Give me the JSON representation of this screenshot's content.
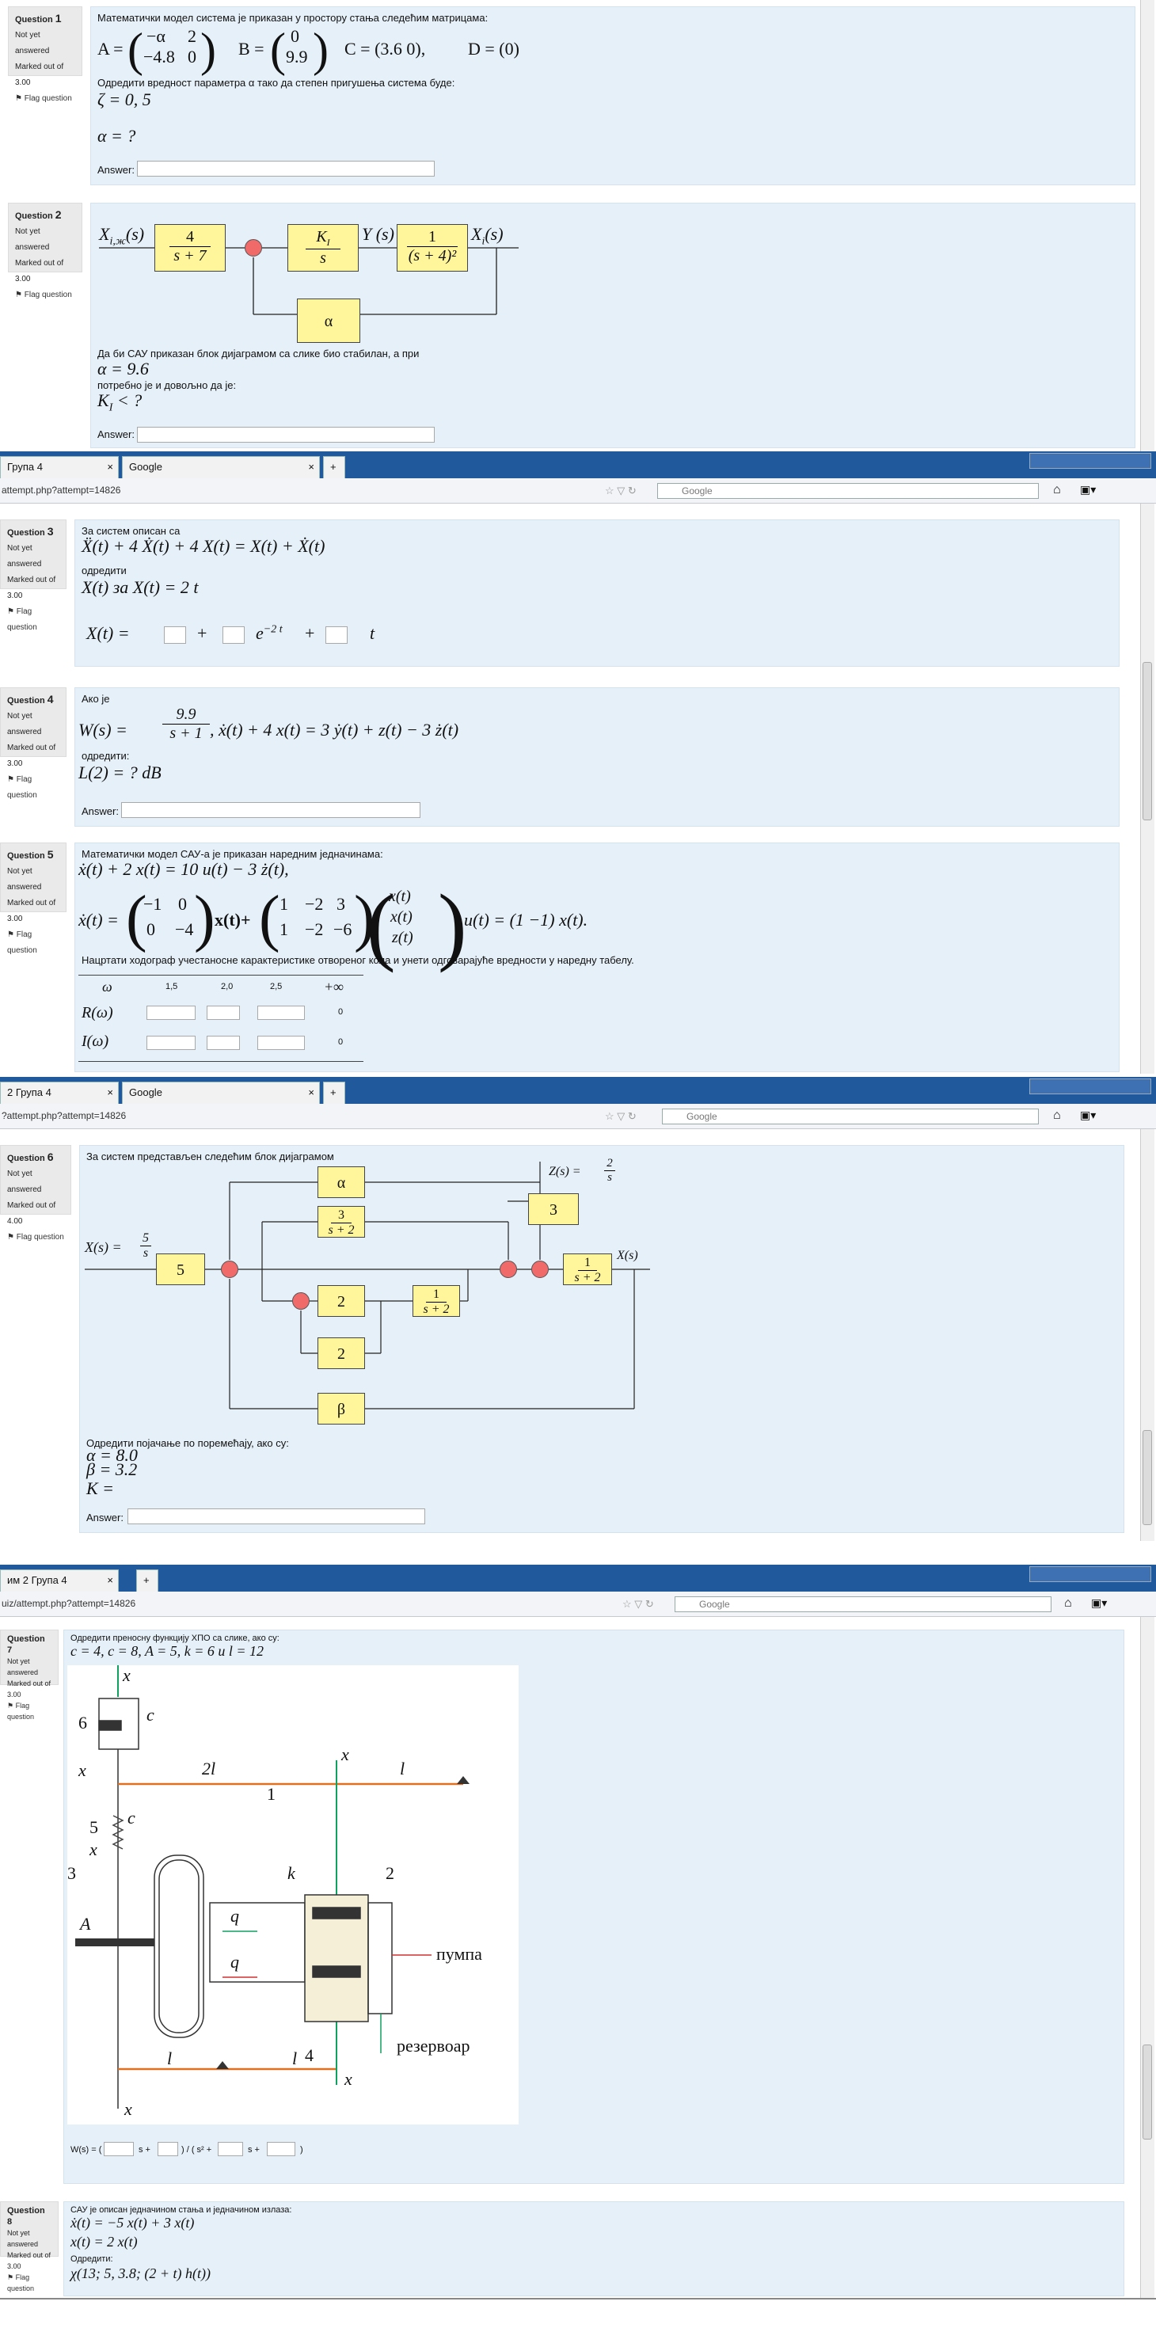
{
  "browser": {
    "tab_title_1": "Група 4",
    "tab_title_2": "Google",
    "tab_title_3": "2 Група 4",
    "tab_title_4": "им 2 Група 4",
    "url_1": "attempt.php?attempt=14826",
    "url_2": "?attempt.php?attempt=14826",
    "url_3": "uiz/attempt.php?attempt=14826",
    "search_placeholder": "Google",
    "new_tab": "+"
  },
  "status": {
    "not_answered": "Not yet answered",
    "marked_3": "Marked out of 3.00",
    "marked_4": "Marked out of 4.00",
    "flag": "Flag question",
    "question": "Question",
    "answer": "Answer:"
  },
  "q1": {
    "num": "1",
    "text": "Математички модел система је приказан у простору стања следећим матрицама:",
    "task": "Одредити вредност параметра α тако да степен пригушења система буде:",
    "zeta": "ζ = 0, 5",
    "alpha": "α = ?",
    "A": "A =",
    "A11": "−α",
    "A12": "2",
    "A21": "−4.8",
    "A22": "0",
    "B": "B =",
    "B1": "0",
    "B2": "9.9",
    "C": "C = (3.6   0),",
    "D": "D = (0)"
  },
  "q2": {
    "num": "2",
    "input": "X",
    "input_sub": "i,ж",
    "input_arg": "(s)",
    "b1_num": "4",
    "b1_den": "s + 7",
    "b2_num": "K",
    "b2_num_sub": "I",
    "b2_den": "s",
    "y": "Y (s)",
    "b3_num": "1",
    "b3_den": "(s + 4)²",
    "output": "X",
    "output_sub": "i",
    "output_arg": "(s)",
    "alpha_block": "α",
    "text1": "Да би САУ приказан блок дијаграмом са слике био стабилан, а при",
    "alpha": "α = 9.6",
    "text2": "потребно је и довољно да је:",
    "ki": "K",
    "ki_sub": "I",
    "ki_rest": " < ?"
  },
  "q3": {
    "num": "3",
    "text1": "За систем описан са",
    "eq": "Ẍ(t) + 4 Ẋ(t) + 4 X(t) = X(t) + Ẋ(t)",
    "text2": "одредити",
    "xun": "X(t) за X(t) = 2 t",
    "xun_eq": "X(t) =",
    "plus1": "+",
    "exp": "e",
    "exp_sup": "−2 t",
    "plus2": "+",
    "t": "t"
  },
  "q4": {
    "num": "4",
    "text1": "Ако је",
    "w": "W(s) =",
    "w_num": "9.9",
    "w_den": "s + 1",
    "w_rest": ",     ẋ(t) + 4 x(t) = 3 ẏ(t) + z(t) − 3 ż(t)",
    "text2": "одредити:",
    "lok": "L(2) = ? dB"
  },
  "q5": {
    "num": "5",
    "text1": "Математички модел САУ-а је приказан наредним једначинама:",
    "eq1": "ẋ(t) + 2 x(t) = 10 u(t) − 3 ż(t),",
    "xdot": "ẋ(t) =",
    "m1": [
      "−1",
      "0",
      "0",
      "−4"
    ],
    "xbold": "x(t)+",
    "m2": [
      "1",
      "−2",
      "3",
      "1",
      "−2",
      "−6"
    ],
    "vec": [
      "x(t)",
      "x(t)",
      "z(t)"
    ],
    "u": ",     u(t) = (1   −1) x(t).",
    "text2": "Нацртати ходограф учестаносне карактеристике отвореног кола и унети одговарајуће вредности у наредну табелу.",
    "omega": "ω",
    "c1": "1,5",
    "c2": "2,0",
    "c3": "2,5",
    "c4": "+∞",
    "r": "R(ω)",
    "i": "I(ω)",
    "zero": "0"
  },
  "q6": {
    "num": "6",
    "text": "За систем представљен следећим блок дијаграмом",
    "input": "X(s) =",
    "input_frac_num": "5",
    "input_frac_den": "s",
    "b_in": "5",
    "alpha": "α",
    "beta": "β",
    "b3": "3",
    "b3s_num": "3",
    "b3s_den": "s + 2",
    "b2a": "2",
    "b2b": "2",
    "b1_num": "1",
    "b1_den": "s + 2",
    "bout_num": "1",
    "bout_den": "s + 2",
    "z": "Z(s) =",
    "z_num": "2",
    "z_den": "s",
    "out": "X(s)",
    "task": "Одредити појачање по поремећају, ако су:",
    "a": "α = 8.0",
    "b": "β = 3.2",
    "kz": "K ="
  },
  "q7": {
    "num": "7",
    "text": "Одредити преносну функцију ХПО са слике, ако су:",
    "params": "c = 4, c = 8, A = 5, k = 6 и l = 12",
    "labels": {
      "xu": "x",
      "cp": "c",
      "six": "6",
      "x2": "x",
      "two_l": "2l",
      "x1": "x",
      "l": "l",
      "one": "1",
      "five": "5",
      "co": "c",
      "three": "3",
      "xi_top": "x",
      "kq": "k",
      "two": "2",
      "A": "A",
      "q": "q",
      "pump": "пумпа",
      "res": "резервоар",
      "four": "4",
      "x3": "x",
      "xi": "x",
      "l2": "l",
      "l3": "l"
    },
    "wform": [
      "W(s) = (",
      "s +",
      ") / ( s² +",
      "s +",
      ")"
    ]
  },
  "q8": {
    "num": "8",
    "text": "САУ је описан једначином стања и једначином излаза:",
    "eq1": "ẋ(t) = −5 x(t) + 3 x(t)",
    "eq2": "x(t) = 2 x(t)",
    "task": "Одредити:",
    "chi": "χ(13; 5, 3.8; (2 + t) h(t))"
  }
}
